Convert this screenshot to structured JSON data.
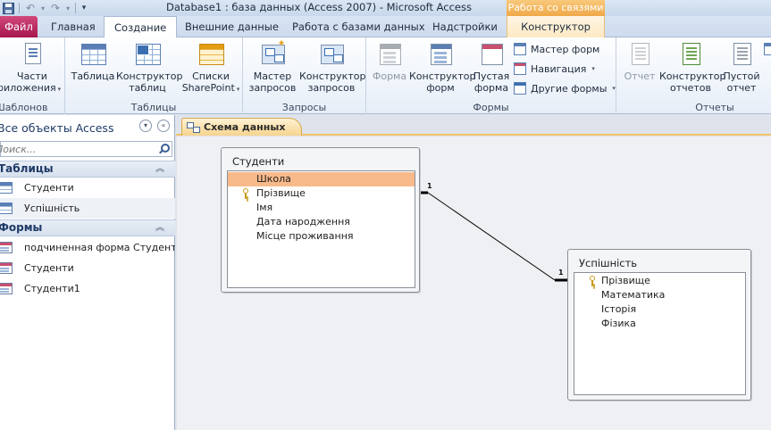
{
  "titlebar": {
    "title": "Database1 : база данных (Access 2007)  -  Microsoft Access",
    "context_group": "Работа со связями"
  },
  "tabs": {
    "file": "Файл",
    "home": "Главная",
    "create": "Создание",
    "external": "Внешние данные",
    "database_tools": "Работа с базами данных",
    "addins": "Надстройки",
    "design": "Конструктор"
  },
  "ribbon": {
    "templates": {
      "label": "Шаблонов",
      "parts_line1": "Части",
      "parts_line2": "приложения"
    },
    "tables": {
      "label": "Таблицы",
      "table": "Таблица",
      "design_line1": "Конструктор",
      "design_line2": "таблиц",
      "sp_line1": "Списки",
      "sp_line2": "SharePoint"
    },
    "queries": {
      "label": "Запросы",
      "wizard_line1": "Мастер",
      "wizard_line2": "запросов",
      "design_line1": "Конструктор",
      "design_line2": "запросов"
    },
    "forms": {
      "label": "Формы",
      "form": "Форма",
      "design_line1": "Конструктор",
      "design_line2": "форм",
      "blank_line1": "Пустая",
      "blank_line2": "форма",
      "wizard": "Мастер форм",
      "navigation": "Навигация",
      "more": "Другие формы"
    },
    "reports": {
      "label": "Отчеты",
      "report": "Отчет",
      "design_line1": "Конструктор",
      "design_line2": "отчетов",
      "blank_line1": "Пустой",
      "blank_line2": "отчет"
    }
  },
  "nav": {
    "header": "Все объекты Access",
    "search_placeholder": "Поиск...",
    "sections": [
      {
        "title": "Таблицы",
        "items": [
          "Студенти",
          "Успішність"
        ]
      },
      {
        "title": "Формы",
        "items": [
          "подчиненная форма Студенти",
          "Студенти",
          "Студенти1"
        ]
      }
    ]
  },
  "document": {
    "tab": "Схема данных"
  },
  "schema": {
    "tables": [
      {
        "name": "Студенти",
        "fields": [
          {
            "name": "Школа",
            "key": false,
            "selected": true
          },
          {
            "name": "Прізвище",
            "key": true,
            "selected": false
          },
          {
            "name": "Імя",
            "key": false,
            "selected": false
          },
          {
            "name": "Дата народження",
            "key": false,
            "selected": false
          },
          {
            "name": "Місце проживання",
            "key": false,
            "selected": false
          }
        ]
      },
      {
        "name": "Успішність",
        "fields": [
          {
            "name": "Прізвище",
            "key": true,
            "selected": false
          },
          {
            "name": "Математика",
            "key": false,
            "selected": false
          },
          {
            "name": "Історія",
            "key": false,
            "selected": false
          },
          {
            "name": "Фізика",
            "key": false,
            "selected": false
          }
        ]
      }
    ],
    "relationship": {
      "left_cardinality": "1",
      "right_cardinality": "1"
    }
  }
}
